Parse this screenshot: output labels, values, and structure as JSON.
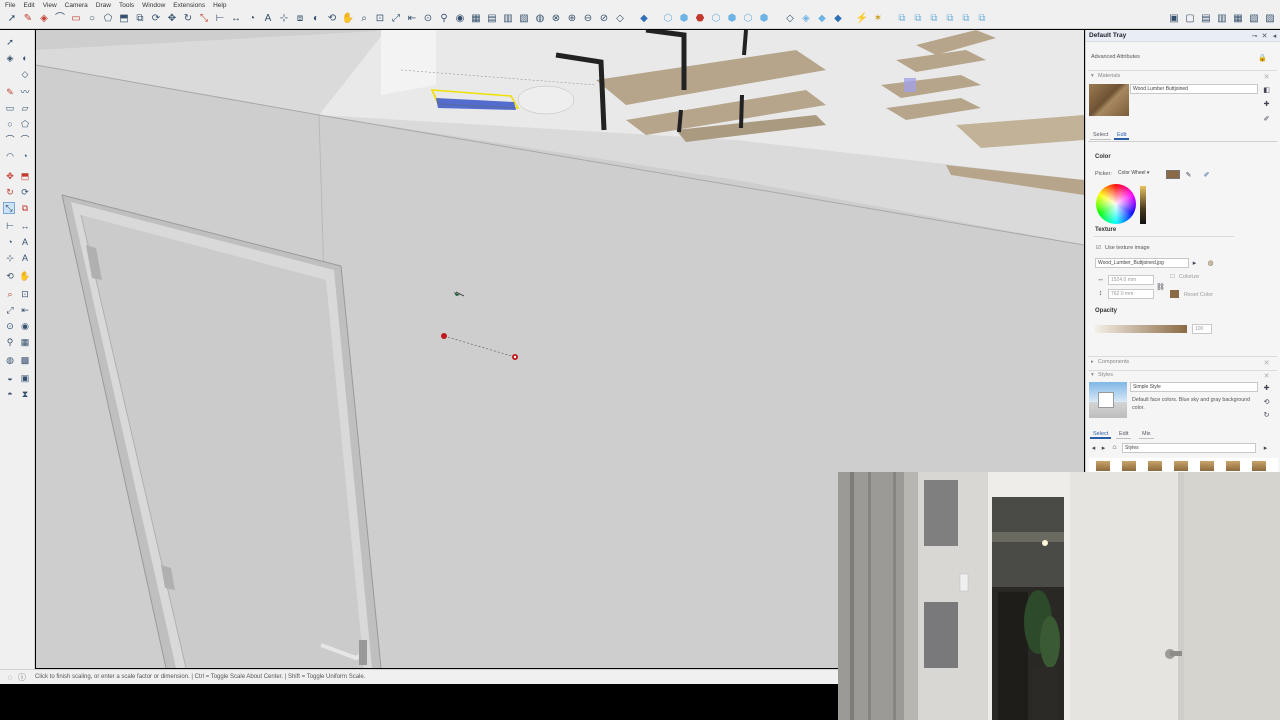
{
  "menu": [
    "File",
    "Edit",
    "View",
    "Camera",
    "Draw",
    "Tools",
    "Window",
    "Extensions",
    "Help"
  ],
  "status_text": "Click to finish scaling, or enter a scale factor or dimension.  |  Ctrl = Toggle Scale About Center.  |  Shift = Toggle Uniform Scale.",
  "tray": {
    "title": "Default Tray",
    "advanced_attributes": "Advanced Attributes",
    "materials_header": "Materials",
    "material_name": "Wood Lumber Buttjoined",
    "tabs": [
      "Select",
      "Edit"
    ],
    "active_tab": "Edit",
    "color_label": "Color",
    "picker_label": "Picker:",
    "picker_value": "Color Wheel",
    "texture_label": "Texture",
    "use_texture_label": "Use texture image",
    "texture_file": "Wood_Lumber_Buttjoined.jpg",
    "width_value": "1524.0 mm",
    "height_value": "762.0 mm",
    "colorize_label": "Colorize",
    "reset_color_label": "Reset Color",
    "opacity_label": "Opacity",
    "opacity_value": "100",
    "components_header": "Components",
    "styles_header": "Styles",
    "style_name": "Simple Style",
    "style_description": "Default face colors. Blue sky and gray background color.",
    "style_tabs": [
      "Select",
      "Edit",
      "Mix"
    ],
    "style_collection": "Styles",
    "swatch_color": "#8a6a44"
  },
  "colors": {
    "ui_bg": "#f0f0f0",
    "accent": "#2a5da8",
    "wall": "#cfcfcf",
    "selection": "#f0e000",
    "point_marker": "#c0191b"
  }
}
